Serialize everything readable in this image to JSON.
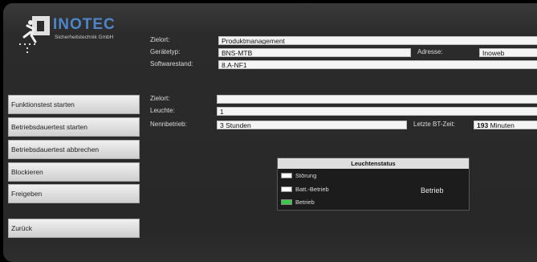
{
  "brand": {
    "name": "INOTEC",
    "subtitle": "Sicherheitstechnik GmbH",
    "color": "#4e86c8"
  },
  "device": {
    "zielort_label": "Zielort:",
    "zielort_value": "Produktmanagement",
    "geraetetyp_label": "Gerätetyp:",
    "geraetetyp_value": "BNS-MTB",
    "adresse_label": "Adresse:",
    "adresse_value": "Inoweb",
    "software_label": "Softwarestand:",
    "software_value": "8.A-NF1"
  },
  "luminaire": {
    "zielort_label": "Zielort:",
    "zielort_value": "",
    "leuchte_label": "Leuchte:",
    "leuchte_value": "1",
    "nennbetrieb_label": "Nennbetrieb:",
    "nennbetrieb_value": "3 Stunden",
    "letzte_bt_label": "Letzte BT-Zeit:",
    "letzte_bt_value": "193",
    "letzte_bt_unit": "Minuten"
  },
  "buttons": {
    "funktionstest": "Funktionstest starten",
    "betriebsdauertest": "Betriebsdauertest starten",
    "abbrechen": "Betriebsdauertest abbrechen",
    "blockieren": "Blockieren",
    "freigeben": "Freigeben",
    "zurueck": "Zurück"
  },
  "status": {
    "title": "Leuchtenstatus",
    "items": [
      {
        "label": "Störung",
        "color": "#ffffff"
      },
      {
        "label": "Batt.-Betrieb",
        "color": "#ffffff"
      },
      {
        "label": "Betrieb",
        "color": "#3cc84a"
      }
    ],
    "current": "Betrieb"
  }
}
